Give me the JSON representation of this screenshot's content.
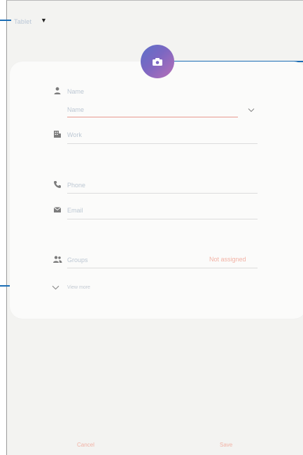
{
  "header": {
    "storage_label": "Tablet"
  },
  "form": {
    "name_label": "Name",
    "name_placeholder": "Name",
    "work_placeholder": "Work",
    "phone_placeholder": "Phone",
    "email_placeholder": "Email",
    "groups_label": "Groups",
    "groups_value": "Not assigned",
    "view_more_label": "View more"
  },
  "footer": {
    "cancel_label": "Cancel",
    "save_label": "Save"
  },
  "icons": {
    "avatar": "camera-icon",
    "name": "person-icon",
    "work": "building-icon",
    "phone": "phone-icon",
    "email": "envelope-icon",
    "groups": "people-icon",
    "expand": "chevron-down-icon"
  },
  "colors": {
    "callout": "#1a6db5",
    "accent": "#e89a8f",
    "avatar_start": "#5b71c9",
    "avatar_end": "#b86fb7"
  }
}
